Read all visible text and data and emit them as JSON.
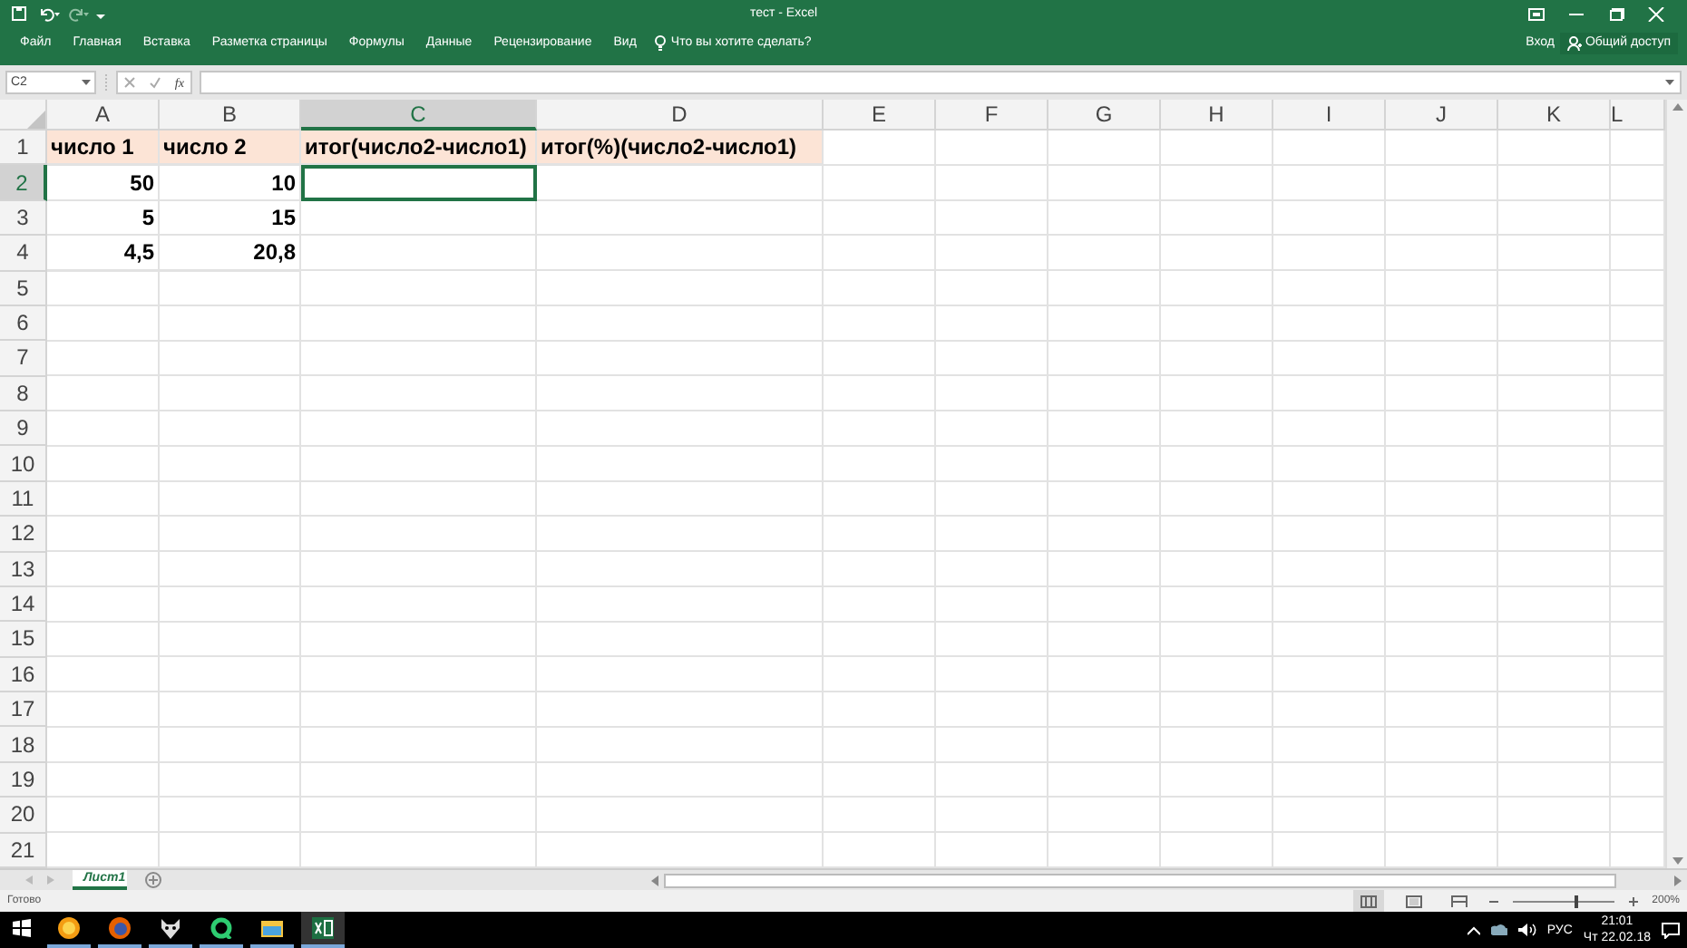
{
  "window": {
    "title": "тест - Excel",
    "sign_in": "Вход",
    "share": "Общий доступ"
  },
  "ribbon_tabs": [
    {
      "label": "Файл",
      "selected": false
    },
    {
      "label": "Главная",
      "selected": false
    },
    {
      "label": "Вставка",
      "selected": false
    },
    {
      "label": "Разметка страницы",
      "selected": false
    },
    {
      "label": "Формулы",
      "selected": false
    },
    {
      "label": "Данные",
      "selected": false
    },
    {
      "label": "Рецензирование",
      "selected": false
    },
    {
      "label": "Вид",
      "selected": false
    }
  ],
  "tell_me": {
    "placeholder": "Что вы хотите сделать?"
  },
  "formula_bar": {
    "name_box": "C2",
    "fx": "fx"
  },
  "columns": [
    {
      "label": "A",
      "selected": false
    },
    {
      "label": "B",
      "selected": false
    },
    {
      "label": "C",
      "selected": true
    },
    {
      "label": "D",
      "selected": false
    },
    {
      "label": "E",
      "selected": false
    },
    {
      "label": "F",
      "selected": false
    },
    {
      "label": "G",
      "selected": false
    },
    {
      "label": "H",
      "selected": false
    },
    {
      "label": "I",
      "selected": false
    },
    {
      "label": "J",
      "selected": false
    },
    {
      "label": "K",
      "selected": false
    },
    {
      "label": "L",
      "selected": false
    }
  ],
  "rows": [
    {
      "number": "1",
      "selected": false,
      "cells": [
        {
          "kind": "text",
          "text": "число 1",
          "highlighted": true
        },
        {
          "kind": "text",
          "text": "число 2",
          "highlighted": true
        },
        {
          "kind": "text",
          "text": "итог(число2-число1)",
          "highlighted": true
        },
        {
          "kind": "text",
          "text": "итог(%)(число2-число1)",
          "highlighted": true
        }
      ]
    },
    {
      "number": "2",
      "selected": true,
      "cells": [
        {
          "kind": "number",
          "text": "50"
        },
        {
          "kind": "number",
          "text": "10"
        },
        {
          "kind": "text",
          "selected": true
        }
      ]
    },
    {
      "number": "3",
      "selected": false,
      "cells": [
        {
          "kind": "number",
          "text": "5"
        },
        {
          "kind": "number",
          "text": "15"
        }
      ]
    },
    {
      "number": "4",
      "selected": false,
      "cells": [
        {
          "kind": "number",
          "text": "4,5"
        },
        {
          "kind": "number",
          "text": "20,8"
        }
      ]
    },
    {
      "number": "5",
      "selected": false
    },
    {
      "number": "6",
      "selected": false
    },
    {
      "number": "7",
      "selected": false
    },
    {
      "number": "8",
      "selected": false
    },
    {
      "number": "9",
      "selected": false
    },
    {
      "number": "10",
      "selected": false
    },
    {
      "number": "11",
      "selected": false
    },
    {
      "number": "12",
      "selected": false
    },
    {
      "number": "13",
      "selected": false
    },
    {
      "number": "14",
      "selected": false
    },
    {
      "number": "15",
      "selected": false
    },
    {
      "number": "16",
      "selected": false
    },
    {
      "number": "17",
      "selected": false
    },
    {
      "number": "18",
      "selected": false
    },
    {
      "number": "19",
      "selected": false
    },
    {
      "number": "20",
      "selected": false
    },
    {
      "number": "21",
      "selected": false
    }
  ],
  "sheet_tabs": [
    {
      "label": "Лист1",
      "selected": true
    }
  ],
  "status_bar": {
    "status": "Готово",
    "zoom": "200%",
    "zoom_slider": {
      "level": 0.64
    }
  },
  "taskbar": {
    "apps": [
      {
        "kind": "orange",
        "active": false
      },
      {
        "kind": "firefox",
        "active": false
      },
      {
        "kind": "mask",
        "active": false
      },
      {
        "kind": "q",
        "active": false
      },
      {
        "kind": "folder",
        "active": false
      },
      {
        "kind": "excel",
        "active": true
      }
    ],
    "language": "РУС",
    "time": "21:01",
    "date": "Чт 22.02.18"
  }
}
